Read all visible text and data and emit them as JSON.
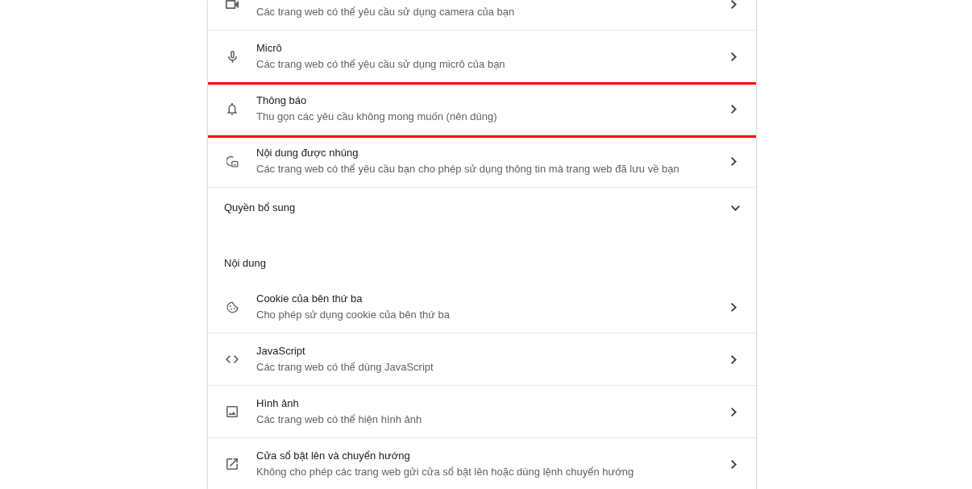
{
  "permissions": {
    "items": [
      {
        "description": "Các trang web có thể yêu cầu sử dụng camera của bạn",
        "highlighted": false
      },
      {
        "title": "Micrô",
        "description": "Các trang web có thể yêu cầu sử dụng micrô của bạn",
        "highlighted": false
      },
      {
        "title": "Thông báo",
        "description": "Thu gọn các yêu cầu không mong muốn (nên dùng)",
        "highlighted": true
      },
      {
        "title": "Nội dung được nhúng",
        "description": "Các trang web có thể yêu cầu bạn cho phép sử dụng thông tin mà trang web đã lưu về bạn",
        "highlighted": false
      }
    ]
  },
  "additional_permissions": {
    "label": "Quyền bổ sung",
    "expanded": false
  },
  "content": {
    "heading": "Nội dung",
    "items": [
      {
        "title": "Cookie của bên thứ ba",
        "description": "Cho phép sử dụng cookie của bên thứ ba"
      },
      {
        "title": "JavaScript",
        "description": "Các trang web có thể dùng JavaScript"
      },
      {
        "title": "Hình ảnh",
        "description": "Các trang web có thể hiện hình ảnh"
      },
      {
        "title": "Cửa sổ bật lên và chuyển hướng",
        "description": "Không cho phép các trang web gửi cửa sổ bật lên hoặc dùng lệnh chuyển hướng"
      }
    ]
  }
}
